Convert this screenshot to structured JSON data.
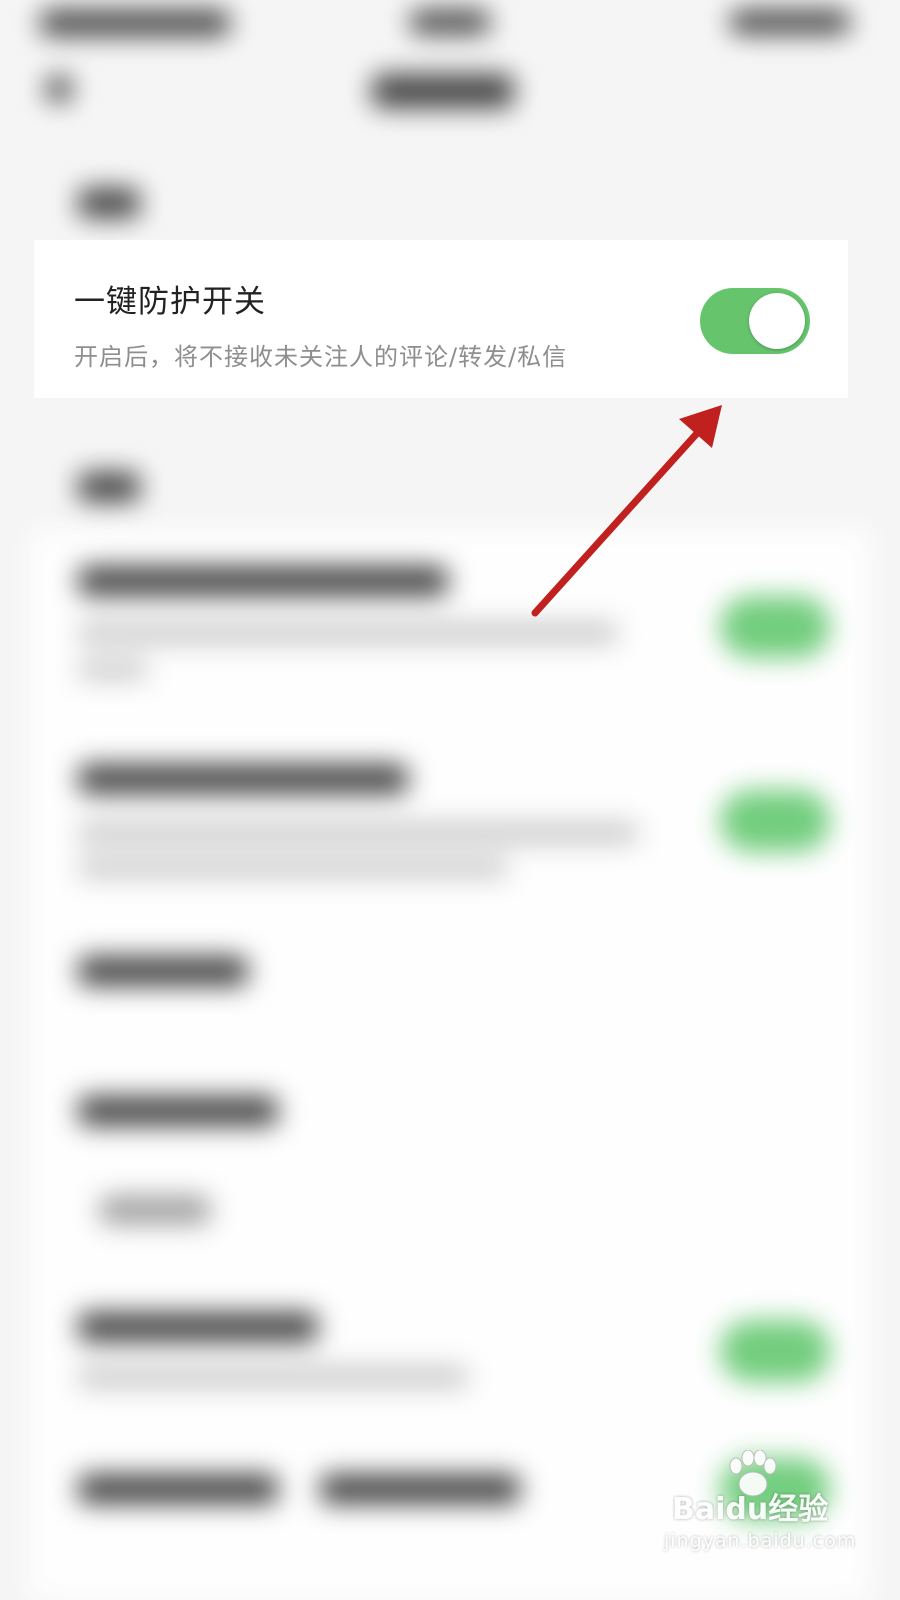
{
  "protection": {
    "title": "一键防护开关",
    "description": "开启后，将不接收未关注人的评论/转发/私信",
    "toggle_state": "on"
  },
  "colors": {
    "toggle_on": "#66c46c",
    "arrow": "#c0201e",
    "background": "#f5f5f5"
  },
  "watermark": {
    "brand": "Baidu经验",
    "url": "jingyan.baidu.com"
  }
}
